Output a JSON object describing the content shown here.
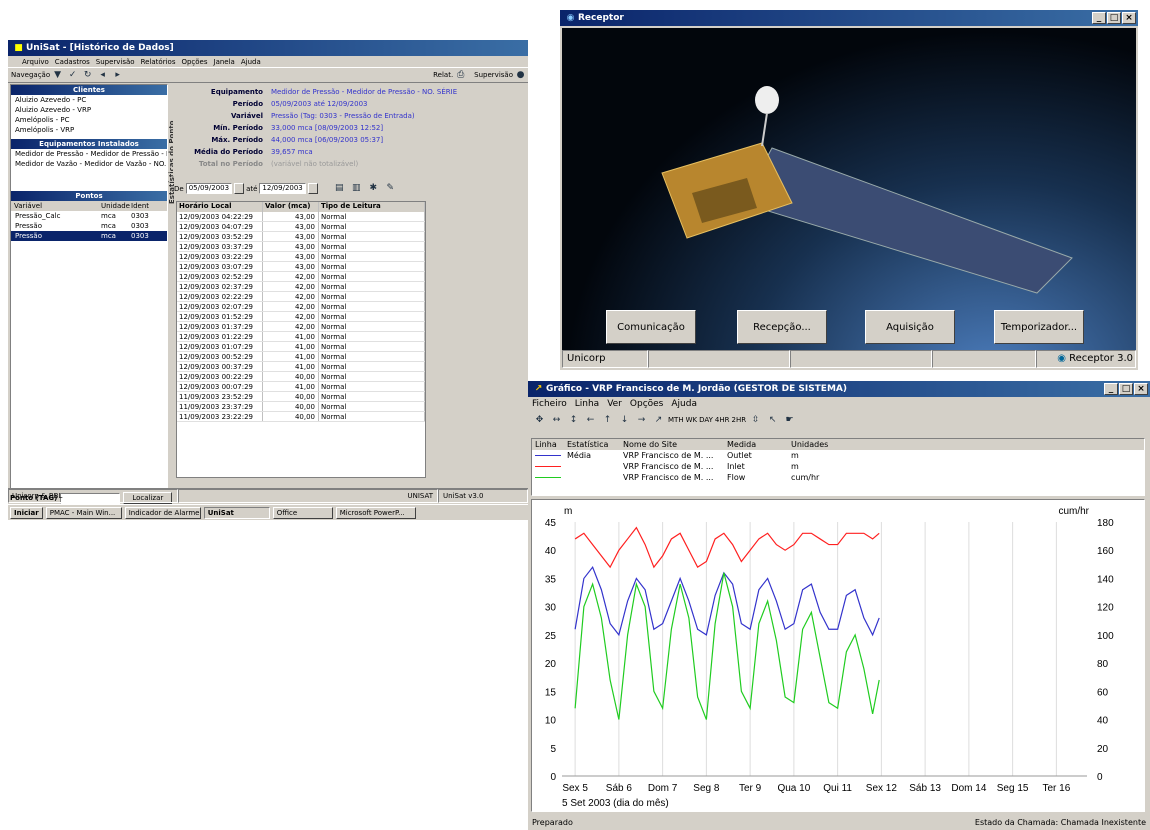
{
  "unisat": {
    "title": "UniSat - [Histórico de Dados]",
    "menu": [
      "Arquivo",
      "Cadastros",
      "Supervisão",
      "Relatórios",
      "Opções",
      "Janela",
      "Ajuda"
    ],
    "toolbar": {
      "navegacao": "Navegação",
      "relat": "Relat.",
      "supervisao": "Supervisão"
    },
    "clientes": {
      "header": "Clientes",
      "items": [
        "Aluizio Azevedo - PC",
        "Aluizio Azevedo - VRP",
        "Amelópolis - PC",
        "Amelópolis - VRP"
      ]
    },
    "equipamentos": {
      "header": "Equipamentos Instalados",
      "items": [
        "Medidor de Pressão - Medidor de Pressão - N",
        "Medidor de Vazão - Medidor de Vazão - NO."
      ]
    },
    "pontos": {
      "header": "Pontos",
      "cols": [
        "Variável",
        "Unidade",
        "Ident"
      ],
      "rows": [
        [
          "Pressão_Calc",
          "mca",
          "0303"
        ],
        [
          "Pressão",
          "mca",
          "0303"
        ],
        [
          "Pressão",
          "mca",
          "0303"
        ]
      ]
    },
    "ponto_tag_label": "Ponto (TAG)",
    "localizar": "Localizar",
    "side_label": "Estatísticas do Ponto",
    "stats": [
      [
        "Equipamento",
        "Medidor de Pressão - Medidor de Pressão - NO. SÉRIE"
      ],
      [
        "Período",
        "05/09/2003 até 12/09/2003"
      ],
      [
        "Variável",
        "Pressão (Tag: 0303 - Pressão de Entrada)"
      ],
      [
        "Mín. Período",
        "33,000 mca [08/09/2003 12:52]"
      ],
      [
        "Máx. Período",
        "44,000 mca [06/09/2003 05:37]"
      ],
      [
        "Média do Período",
        "39,657 mca"
      ],
      [
        "Total no Período",
        "(variável não totalizável)"
      ]
    ],
    "filter": {
      "de": "De",
      "from": "05/09/2003",
      "ate": "até",
      "to": "12/09/2003"
    },
    "grid": {
      "cols": [
        "Horário Local",
        "Valor (mca)",
        "Tipo de Leitura"
      ],
      "rows": [
        [
          "12/09/2003 04:22:29",
          "43,00",
          "Normal"
        ],
        [
          "12/09/2003 04:07:29",
          "43,00",
          "Normal"
        ],
        [
          "12/09/2003 03:52:29",
          "43,00",
          "Normal"
        ],
        [
          "12/09/2003 03:37:29",
          "43,00",
          "Normal"
        ],
        [
          "12/09/2003 03:22:29",
          "43,00",
          "Normal"
        ],
        [
          "12/09/2003 03:07:29",
          "43,00",
          "Normal"
        ],
        [
          "12/09/2003 02:52:29",
          "42,00",
          "Normal"
        ],
        [
          "12/09/2003 02:37:29",
          "42,00",
          "Normal"
        ],
        [
          "12/09/2003 02:22:29",
          "42,00",
          "Normal"
        ],
        [
          "12/09/2003 02:07:29",
          "42,00",
          "Normal"
        ],
        [
          "12/09/2003 01:52:29",
          "42,00",
          "Normal"
        ],
        [
          "12/09/2003 01:37:29",
          "42,00",
          "Normal"
        ],
        [
          "12/09/2003 01:22:29",
          "41,00",
          "Normal"
        ],
        [
          "12/09/2003 01:07:29",
          "41,00",
          "Normal"
        ],
        [
          "12/09/2003 00:52:29",
          "41,00",
          "Normal"
        ],
        [
          "12/09/2003 00:37:29",
          "41,00",
          "Normal"
        ],
        [
          "12/09/2003 00:22:29",
          "40,00",
          "Normal"
        ],
        [
          "12/09/2003 00:07:29",
          "41,00",
          "Normal"
        ],
        [
          "11/09/2003 23:52:29",
          "40,00",
          "Normal"
        ],
        [
          "11/09/2003 23:37:29",
          "40,00",
          "Normal"
        ],
        [
          "11/09/2003 23:22:29",
          "40,00",
          "Normal"
        ]
      ]
    },
    "status": {
      "left": "Unicorp & BBL",
      "mid": "UNISAT",
      "right": "UniSat v3.0"
    },
    "taskbar": [
      "Iniciar",
      "PMAC - Main Win...",
      "Indicador de Alarme",
      "UniSat",
      "Office",
      "Microsoft PowerP..."
    ]
  },
  "receptor": {
    "title": "Receptor",
    "buttons": [
      "Comunicação",
      "Recepção...",
      "Aquisição",
      "Temporizador..."
    ],
    "status": {
      "left": "Unicorp",
      "right": "Receptor 3.0"
    }
  },
  "grafico": {
    "title": "Gráfico - VRP Francisco de M. Jordão (GESTOR DE SISTEMA)",
    "menu": [
      "Ficheiro",
      "Linha",
      "Ver",
      "Opções",
      "Ajuda"
    ],
    "toolbar_text": [
      "MTH",
      "WK",
      "DAY",
      "4HR",
      "2HR"
    ],
    "legend_cols": [
      "Linha",
      "Estatística",
      "Nome do Site",
      "Medida",
      "Unidades"
    ],
    "legend_rows": [
      {
        "color": "#3333cc",
        "stat": "Média",
        "site": "VRP Francisco de M. ...",
        "medida": "Outlet",
        "unid": "m"
      },
      {
        "color": "#ff2020",
        "stat": "",
        "site": "VRP Francisco de M. ...",
        "medida": "Inlet",
        "unid": "m"
      },
      {
        "color": "#20cc20",
        "stat": "",
        "site": "VRP Francisco de M. ...",
        "medida": "Flow",
        "unid": "cum/hr"
      }
    ],
    "status": {
      "left": "Preparado",
      "right": "Estado da Chamada: Chamada Inexistente"
    }
  },
  "chart_data": {
    "type": "line",
    "ylabel": "m",
    "y2label": "cum/hr",
    "ylim": [
      0,
      45
    ],
    "y2lim": [
      0,
      180
    ],
    "yticks": [
      0,
      5,
      10,
      15,
      20,
      25,
      30,
      35,
      40,
      45
    ],
    "y2ticks": [
      0,
      20,
      40,
      60,
      80,
      100,
      120,
      140,
      160,
      180
    ],
    "xticks": [
      "Sex 5",
      "Sáb 6",
      "Dom 7",
      "Seg 8",
      "Ter 9",
      "Qua 10",
      "Qui 11",
      "Sex 12",
      "Sáb 13",
      "Dom 14",
      "Seg 15",
      "Ter 16"
    ],
    "xlabel": "5 Set 2003 (dia do mês)",
    "grid": true,
    "series": [
      {
        "name": "Outlet",
        "color": "#3333cc",
        "x": [
          5,
          5.2,
          5.4,
          5.6,
          5.8,
          6,
          6.2,
          6.4,
          6.6,
          6.8,
          7,
          7.2,
          7.4,
          7.6,
          7.8,
          8,
          8.2,
          8.4,
          8.6,
          8.8,
          9,
          9.2,
          9.4,
          9.6,
          9.8,
          10,
          10.2,
          10.4,
          10.6,
          10.8,
          11,
          11.2,
          11.4,
          11.6,
          11.8,
          11.95
        ],
        "y": [
          26,
          35,
          37,
          33,
          27,
          25,
          31,
          35,
          33,
          26,
          27,
          31,
          35,
          31,
          26,
          25,
          32,
          36,
          34,
          27,
          26,
          33,
          35,
          31,
          26,
          27,
          33,
          34,
          29,
          26,
          26,
          32,
          33,
          28,
          25,
          28
        ]
      },
      {
        "name": "Inlet",
        "color": "#ff2020",
        "x": [
          5,
          5.2,
          5.4,
          5.6,
          5.8,
          6,
          6.2,
          6.4,
          6.6,
          6.8,
          7,
          7.2,
          7.4,
          7.6,
          7.8,
          8,
          8.2,
          8.4,
          8.6,
          8.8,
          9,
          9.2,
          9.4,
          9.6,
          9.8,
          10,
          10.2,
          10.4,
          10.6,
          10.8,
          11,
          11.2,
          11.4,
          11.6,
          11.8,
          11.95
        ],
        "y": [
          42,
          43,
          41,
          39,
          37,
          40,
          42,
          44,
          41,
          37,
          39,
          42,
          43,
          40,
          37,
          38,
          42,
          43,
          41,
          38,
          40,
          42,
          43,
          41,
          40,
          41,
          43,
          43,
          42,
          41,
          41,
          43,
          43,
          43,
          42,
          43
        ]
      },
      {
        "name": "Flow",
        "color": "#20cc20",
        "x": [
          5,
          5.2,
          5.4,
          5.6,
          5.8,
          6,
          6.2,
          6.4,
          6.6,
          6.8,
          7,
          7.2,
          7.4,
          7.6,
          7.8,
          8,
          8.2,
          8.4,
          8.6,
          8.8,
          9,
          9.2,
          9.4,
          9.6,
          9.8,
          10,
          10.2,
          10.4,
          10.6,
          10.8,
          11,
          11.2,
          11.4,
          11.6,
          11.8,
          11.95
        ],
        "y": [
          12,
          30,
          34,
          28,
          17,
          10,
          25,
          34,
          30,
          15,
          12,
          26,
          34,
          28,
          14,
          10,
          27,
          36,
          30,
          15,
          12,
          27,
          31,
          24,
          14,
          13,
          26,
          29,
          21,
          13,
          12,
          22,
          25,
          19,
          11,
          17
        ]
      }
    ]
  }
}
